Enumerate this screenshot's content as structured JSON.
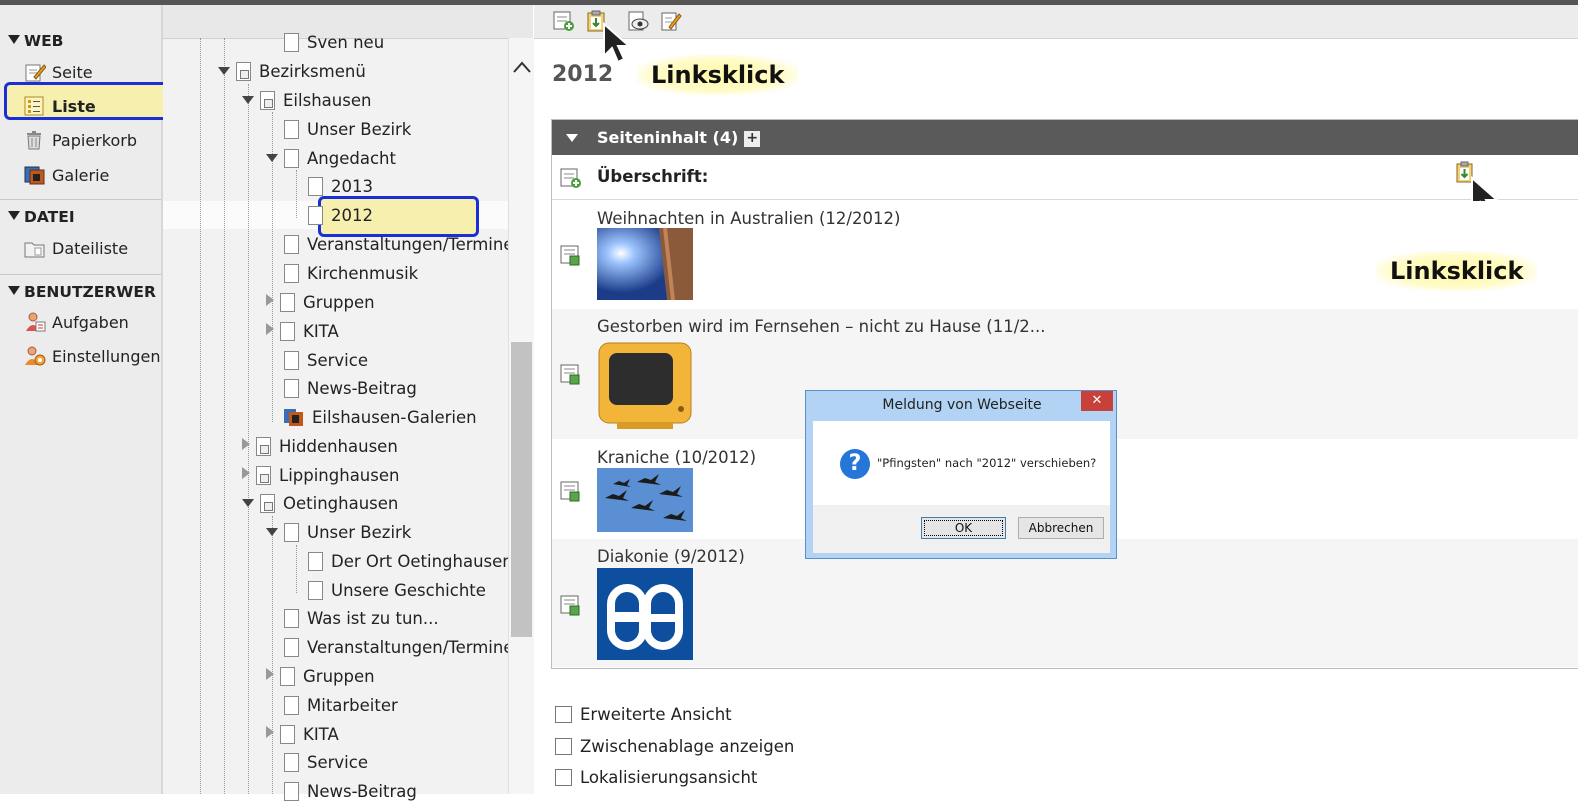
{
  "modules": {
    "groups": [
      {
        "label": "WEB"
      },
      {
        "label": "DATEI"
      },
      {
        "label": "BENUTZERWER"
      }
    ],
    "items": [
      {
        "label": "Seite",
        "icon": "page-edit-icon"
      },
      {
        "label": "Liste",
        "icon": "list-icon"
      },
      {
        "label": "Papierkorb",
        "icon": "trash-icon"
      },
      {
        "label": "Galerie",
        "icon": "gallery-icon"
      },
      {
        "label": "Dateiliste",
        "icon": "folder-icon"
      },
      {
        "label": "Aufgaben",
        "icon": "tasks-icon"
      },
      {
        "label": "Einstellungen",
        "icon": "user-settings-icon"
      }
    ]
  },
  "tree": {
    "nodes": [
      "Sven neu",
      "Bezirksmenü",
      "Eilshausen",
      "Unser Bezirk",
      "Angedacht",
      "2013",
      "2012",
      "Veranstaltungen/Termine",
      "Kirchenmusik",
      "Gruppen",
      "KITA",
      "Service",
      "News-Beitrag",
      "Eilshausen-Galerien",
      "Hiddenhausen",
      "Lippinghausen",
      "Oetinghausen",
      "Unser Bezirk",
      "Der Ort Oetinghausen",
      "Unsere Geschichte",
      "Was ist zu tun...",
      "Veranstaltungen/Termine",
      "Gruppen",
      "Mitarbeiter",
      "KITA",
      "Service",
      "News-Beitrag"
    ]
  },
  "content": {
    "title": "2012",
    "annotation_top": "Linksklick",
    "annotation_right": "Linksklick",
    "section_header": "Seiteninhalt (4)",
    "heading_label": "Überschrift:",
    "records": [
      {
        "title": "Weihnachten in Australien (12/2012)"
      },
      {
        "title": "Gestorben wird im Fernsehen – nicht zu Hause (11/2..."
      },
      {
        "title": "Kraniche (10/2012)"
      },
      {
        "title": "Diakonie (9/2012)"
      }
    ],
    "options": [
      {
        "label": "Erweiterte Ansicht"
      },
      {
        "label": "Zwischenablage anzeigen"
      },
      {
        "label": "Lokalisierungsansicht"
      }
    ]
  },
  "dialog": {
    "title": "Meldung von Webseite",
    "close": "✕",
    "message": "\"Pfingsten\" nach \"2012\" verschieben?",
    "ok": "OK",
    "cancel": "Abbrechen"
  },
  "colors": {
    "highlight_border": "#1a2fd8",
    "highlight_fill": "#f6efae",
    "panel_header": "#5a5a5a",
    "dialog_frame": "#b3d3f4"
  }
}
